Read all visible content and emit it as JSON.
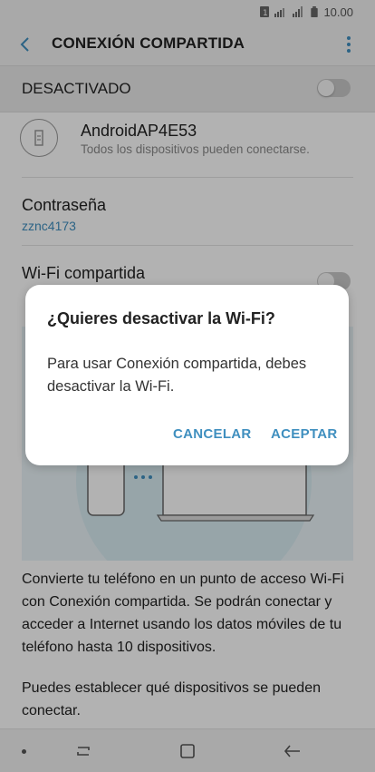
{
  "status_bar": {
    "time": "10.00"
  },
  "app_bar": {
    "title": "CONEXIÓN COMPARTIDA"
  },
  "master_toggle": {
    "label": "DESACTIVADO",
    "state": "off"
  },
  "network": {
    "name": "AndroidAP4E53",
    "subtitle": "Todos los dispositivos pueden conectarse."
  },
  "password": {
    "label": "Contraseña",
    "value": "zznc4173"
  },
  "wifi_sharing": {
    "label": "Wi-Fi compartida",
    "state": "off"
  },
  "description": {
    "paragraph1": "Convierte tu teléfono en un punto de acceso Wi-Fi con Conexión compartida. Se podrán conectar y acceder a Internet usando los datos móviles de tu teléfono hasta 10 dispositivos.",
    "paragraph2": "Puedes establecer qué dispositivos se pueden conectar."
  },
  "dialog": {
    "title": "¿Quieres desactivar la Wi-Fi?",
    "body": "Para usar Conexión compartida, debes desactivar la Wi-Fi.",
    "cancel_label": "CANCELAR",
    "accept_label": "ACEPTAR"
  },
  "colors": {
    "accent": "#3f8fbf"
  }
}
